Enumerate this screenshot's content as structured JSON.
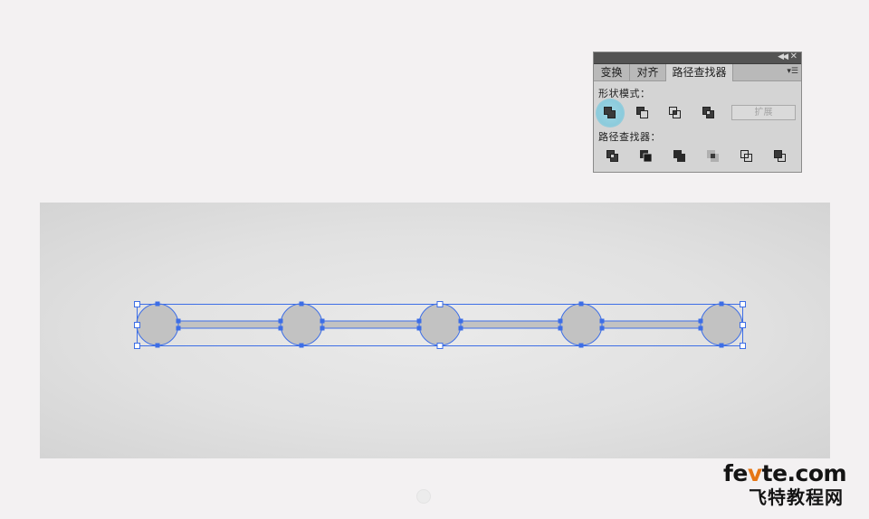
{
  "panel": {
    "tabs": [
      {
        "label": "变换"
      },
      {
        "label": "对齐"
      },
      {
        "label": "路径查找器"
      }
    ],
    "active_tab": "路径查找器",
    "shape_modes_label": "形状模式：",
    "pathfinders_label": "路径查找器：",
    "expand_label": "扩展",
    "shape_mode_buttons": [
      "unite-icon",
      "minus-front-icon",
      "intersect-icon",
      "exclude-icon"
    ],
    "pathfinder_buttons": [
      "divide-icon",
      "trim-icon",
      "merge-icon",
      "crop-icon",
      "outline-icon",
      "minus-back-icon"
    ],
    "highlighted_button": "unite-icon"
  },
  "artboard": {
    "circle_count": 5,
    "connector_count": 4,
    "fill_color": "#c2c2c2",
    "selection_color": "#3d6ee6"
  },
  "watermark": {
    "domain_prefix": "fe",
    "domain_accent": "v",
    "domain_suffix": "te.com",
    "site_name": "飞特教程网"
  }
}
